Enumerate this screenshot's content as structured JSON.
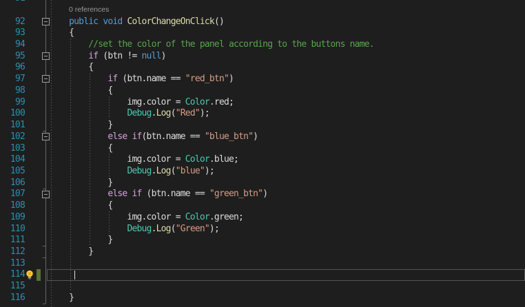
{
  "window": {
    "title": "Visual Studio code editor - C# script"
  },
  "colors": {
    "background": "#1e1e1e",
    "line_number": "#2b91af",
    "keyword": "#569cd6",
    "control": "#d8a0df",
    "method": "#dcdcaa",
    "type": "#4ec9b0",
    "string": "#d69d85",
    "comment": "#57a64a",
    "plain": "#dcdcdc",
    "codelens": "#9a9a9a",
    "indent_guide": "#4a4a4a",
    "fold_line": "#666666",
    "fold_box_border": "#a0a0a0",
    "current_line_border": "#565656",
    "change_bar": "#577430",
    "caret": "#dcdcdc",
    "lightbulb": "#fcc92a",
    "lightbulb_base": "#b5b5b5"
  },
  "codelens": {
    "text": "0 references"
  },
  "editor": {
    "language": "csharp",
    "rows": [
      {
        "line": 91,
        "tokens": []
      },
      {
        "type": "codelens",
        "text": "0 references"
      },
      {
        "line": 92,
        "tokens": [
          [
            "pl",
            "    "
          ],
          [
            "kw",
            "public"
          ],
          [
            "pl",
            " "
          ],
          [
            "kw",
            "void"
          ],
          [
            "pl",
            " "
          ],
          [
            "fn",
            "ColorChangeOnClick"
          ],
          [
            "pl",
            "()"
          ]
        ]
      },
      {
        "line": 93,
        "tokens": [
          [
            "pl",
            "    {"
          ]
        ]
      },
      {
        "line": 94,
        "tokens": [
          [
            "pl",
            "        "
          ],
          [
            "cmt",
            "//set the color of the panel according to the buttons name."
          ]
        ]
      },
      {
        "line": 95,
        "tokens": [
          [
            "pl",
            "        "
          ],
          [
            "ctrl",
            "if"
          ],
          [
            "pl",
            " (btn != "
          ],
          [
            "kw",
            "null"
          ],
          [
            "pl",
            ")"
          ]
        ]
      },
      {
        "line": 96,
        "tokens": [
          [
            "pl",
            "        {"
          ]
        ]
      },
      {
        "line": 97,
        "tokens": [
          [
            "pl",
            "            "
          ],
          [
            "ctrl",
            "if"
          ],
          [
            "pl",
            " (btn.name == "
          ],
          [
            "str",
            "\"red_btn\""
          ],
          [
            "pl",
            ")"
          ]
        ]
      },
      {
        "line": 98,
        "tokens": [
          [
            "pl",
            "            {"
          ]
        ]
      },
      {
        "line": 99,
        "tokens": [
          [
            "pl",
            "                img.color = "
          ],
          [
            "cls",
            "Color"
          ],
          [
            "pl",
            ".red;"
          ]
        ]
      },
      {
        "line": 100,
        "tokens": [
          [
            "pl",
            "                "
          ],
          [
            "cls",
            "Debug"
          ],
          [
            "pl",
            "."
          ],
          [
            "fn",
            "Log"
          ],
          [
            "pl",
            "("
          ],
          [
            "str",
            "\"Red\""
          ],
          [
            "pl",
            ");"
          ]
        ]
      },
      {
        "line": 101,
        "tokens": [
          [
            "pl",
            "            }"
          ]
        ]
      },
      {
        "line": 102,
        "tokens": [
          [
            "pl",
            "            "
          ],
          [
            "ctrl",
            "else"
          ],
          [
            "pl",
            " "
          ],
          [
            "ctrl",
            "if"
          ],
          [
            "pl",
            "(btn.name == "
          ],
          [
            "str",
            "\"blue_btn\""
          ],
          [
            "pl",
            ")"
          ]
        ]
      },
      {
        "line": 103,
        "tokens": [
          [
            "pl",
            "            {"
          ]
        ]
      },
      {
        "line": 104,
        "tokens": [
          [
            "pl",
            "                img.color = "
          ],
          [
            "cls",
            "Color"
          ],
          [
            "pl",
            ".blue;"
          ]
        ]
      },
      {
        "line": 105,
        "tokens": [
          [
            "pl",
            "                "
          ],
          [
            "cls",
            "Debug"
          ],
          [
            "pl",
            "."
          ],
          [
            "fn",
            "Log"
          ],
          [
            "pl",
            "("
          ],
          [
            "str",
            "\"blue\""
          ],
          [
            "pl",
            ");"
          ]
        ]
      },
      {
        "line": 106,
        "tokens": [
          [
            "pl",
            "            }"
          ]
        ]
      },
      {
        "line": 107,
        "tokens": [
          [
            "pl",
            "            "
          ],
          [
            "ctrl",
            "else"
          ],
          [
            "pl",
            " "
          ],
          [
            "ctrl",
            "if"
          ],
          [
            "pl",
            " (btn.name == "
          ],
          [
            "str",
            "\"green_btn\""
          ],
          [
            "pl",
            ")"
          ]
        ]
      },
      {
        "line": 108,
        "tokens": [
          [
            "pl",
            "            {"
          ]
        ]
      },
      {
        "line": 109,
        "tokens": [
          [
            "pl",
            "                img.color = "
          ],
          [
            "cls",
            "Color"
          ],
          [
            "pl",
            ".green;"
          ]
        ]
      },
      {
        "line": 110,
        "tokens": [
          [
            "pl",
            "                "
          ],
          [
            "cls",
            "Debug"
          ],
          [
            "pl",
            "."
          ],
          [
            "fn",
            "Log"
          ],
          [
            "pl",
            "("
          ],
          [
            "str",
            "\"Green\""
          ],
          [
            "pl",
            ");"
          ]
        ]
      },
      {
        "line": 111,
        "tokens": [
          [
            "pl",
            "            }"
          ]
        ]
      },
      {
        "line": 112,
        "tokens": [
          [
            "pl",
            "        }"
          ]
        ]
      },
      {
        "line": 113,
        "tokens": []
      },
      {
        "line": 114,
        "tokens": []
      },
      {
        "line": 115,
        "tokens": []
      },
      {
        "line": 116,
        "tokens": [
          [
            "pl",
            "    }"
          ]
        ]
      }
    ],
    "indent_guides": [
      {
        "col": 0,
        "from": 91,
        "to": 118
      },
      {
        "col": 4,
        "from": 94,
        "to": 116
      },
      {
        "col": 8,
        "from": 97,
        "to": 112
      },
      {
        "col": 12,
        "from": 99,
        "to": 101
      },
      {
        "col": 12,
        "from": 104,
        "to": 106
      },
      {
        "col": 12,
        "from": 109,
        "to": 111
      }
    ],
    "folding": {
      "collapse_markers": [
        92,
        95,
        97,
        102,
        107
      ],
      "end_markers": [
        101,
        106,
        111,
        112,
        116
      ]
    },
    "current_line": 114,
    "caret": {
      "line": 114,
      "column": 5
    },
    "change_bar_lines": [
      114
    ],
    "lightbulb_line": 114
  }
}
